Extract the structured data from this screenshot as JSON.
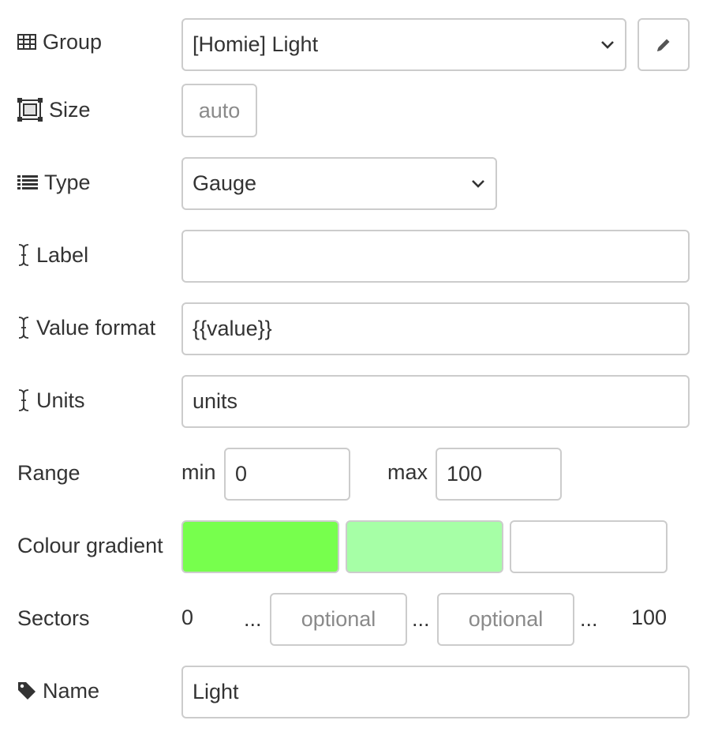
{
  "group": {
    "label": "Group",
    "icon": "table-icon",
    "value": "[Homie] Light",
    "edit_icon": "pencil-icon"
  },
  "size": {
    "label": "Size",
    "icon": "size-icon",
    "value": "auto"
  },
  "type": {
    "label": "Type",
    "icon": "list-icon",
    "value": "Gauge"
  },
  "label_field": {
    "label": "Label",
    "icon": "text-cursor-icon",
    "value": ""
  },
  "value_format": {
    "label": "Value format",
    "icon": "text-cursor-icon",
    "value": "{{value}}"
  },
  "units": {
    "label": "Units",
    "icon": "text-cursor-icon",
    "value": "units"
  },
  "range": {
    "label": "Range",
    "min_label": "min",
    "min_value": "0",
    "max_label": "max",
    "max_value": "100"
  },
  "colour_gradient": {
    "label": "Colour gradient",
    "colors": [
      "#77ff4d",
      "#a6ffa6",
      "#ffffff"
    ]
  },
  "sectors": {
    "label": "Sectors",
    "start": "0",
    "sep": "...",
    "sector1_placeholder": "optional",
    "sector2_placeholder": "optional",
    "end": "100"
  },
  "name": {
    "label": "Name",
    "icon": "tag-icon",
    "value": "Light"
  }
}
